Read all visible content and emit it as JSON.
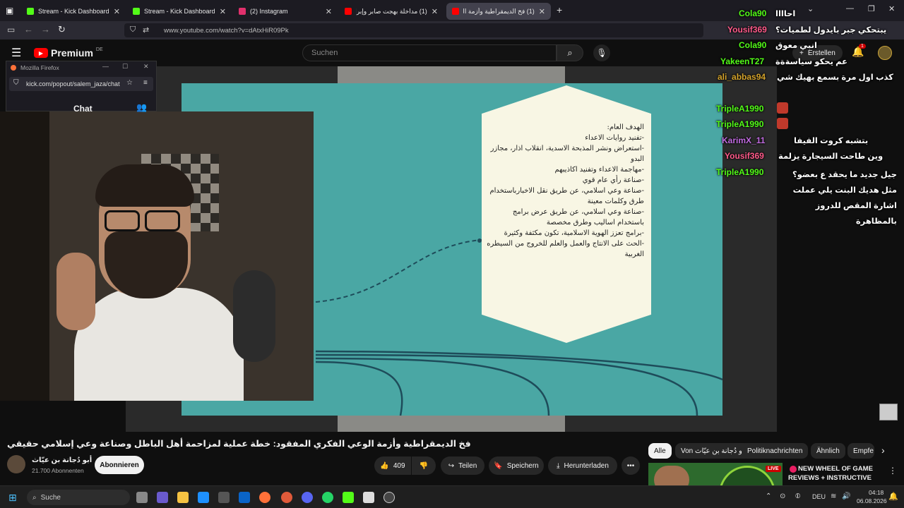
{
  "tabs": [
    {
      "label": "Stream - Kick Dashboard",
      "color": "#53fc18"
    },
    {
      "label": "Stream - Kick Dashboard",
      "color": "#53fc18"
    },
    {
      "label": "(2) Instagram",
      "color": "#e1306c"
    },
    {
      "label": "(1) مداخلة بهجت صابر وإبراهيم ...",
      "color": "#ff0000"
    },
    {
      "label": "(1) فخ الديمقراطية وأزمة الوعي ...",
      "color": "#ff0000"
    }
  ],
  "url": "www.youtube.com/watch?v=dAtxHiR09Pk",
  "youtube": {
    "logo": "Premium",
    "region": "DE",
    "search_placeholder": "Suchen",
    "create_label": "Erstellen",
    "notif_count": "1"
  },
  "popup": {
    "title": "Mozilla Firefox",
    "url": "kick.com/popout/salem_jaza/chat",
    "chat_label": "Chat"
  },
  "chat": [
    {
      "user": "Cola90",
      "color": "#53fc18",
      "msg": "احاااا"
    },
    {
      "user": "Yousif369",
      "color": "#ff5a8a",
      "msg": "يبتحكي جبر بايدول لطميات؟"
    },
    {
      "user": "Cola90",
      "color": "#53fc18",
      "msg": "انبي معوق"
    },
    {
      "user": "YakeenT27",
      "color": "#53fc18",
      "msg": "عم يحكو سياسةةة"
    },
    {
      "user": "ali_abbas94",
      "color": "#d4a32b",
      "msg": "كذب اول مرة بسمع بهيك شي"
    },
    {
      "user": "TripleA1990",
      "color": "#53fc18",
      "msg": ""
    },
    {
      "user": "TripleA1990",
      "color": "#53fc18",
      "msg": ""
    },
    {
      "user": "KarimX_11",
      "color": "#c06be0",
      "msg": "بتشبه كروت الفيفا"
    },
    {
      "user": "Yousif369",
      "color": "#ff5a8a",
      "msg": "وين طاحت السيجارة يزلمة"
    },
    {
      "user": "TripleA1990",
      "color": "#53fc18",
      "msg": "جيل جديد ما يحقد ع بعضو؟ مثل هديك البنت يلي عملت اشارة المقص للدروز بالمظاهرة"
    }
  ],
  "slide": {
    "heading": "الهدف العام:",
    "lines": [
      "-تفنيد روايات الاعداء",
      "-استعراض ونشر المذبحة الاسدية، انقلاب اذار، مجازر البدو",
      "-مهاجمة الاعداء وتفنيد اكاذيبهم",
      "-صناعة رأي عام قوي",
      "-صناعة وعي اسلامي، عن طريق نقل الاخبارباستخدام طرق وكلمات معينة",
      "-صناعة وعي اسلامي، عن طريق عرض برامج باستخدام اساليب وطرق مخصصة",
      "-برامج تعزز الهوية الاسلامية، تكون مكثفة وكثيرة",
      "-الحث على الانتاج والعمل والعلم للخروج من السيطره الغربية"
    ]
  },
  "video": {
    "title": "فخ الديمقراطية وأزمة الوعي الفكري المفقود: خطة عملية لمزاحمة أهل الباطل وصناعة وعي إسلامي حقيقي",
    "channel": "أبو دُجانة بن عيّاث",
    "subscribers": "21.700 Abonnenten",
    "subscribe_label": "Abonnieren",
    "likes": "409",
    "share_label": "Teilen",
    "save_label": "Speichern",
    "download_label": "Herunterladen"
  },
  "chips": [
    "Alle",
    "Von أبو دُجانة بن عيّاث",
    "Politiknachrichten",
    "Ähnlich",
    "Empfe"
  ],
  "recommended": {
    "live": "LIVE",
    "title": "NEW WHEEL OF GAME REVIEWS + INSTRUCTIVE ..."
  },
  "taskbar": {
    "search_placeholder": "Suche",
    "lang": "DEU",
    "time": "04:18",
    "date": "06.08.2026"
  }
}
